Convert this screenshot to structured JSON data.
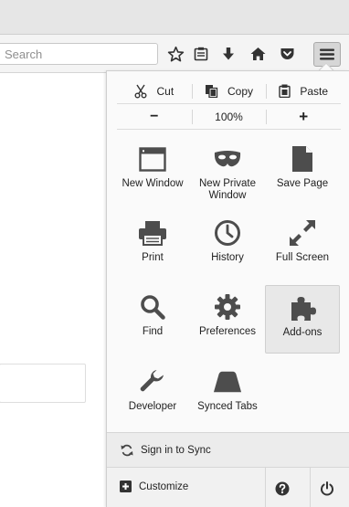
{
  "toolbar": {
    "search_placeholder": "Search",
    "bookmark_icon": "star-outline-icon",
    "reading_list_icon": "clipboard-icon",
    "downloads_icon": "download-arrow-icon",
    "home_icon": "home-icon",
    "pocket_icon": "pocket-icon",
    "menu_icon": "hamburger-icon"
  },
  "menu": {
    "edit": {
      "cut": "Cut",
      "copy": "Copy",
      "paste": "Paste"
    },
    "zoom": {
      "minus": "−",
      "level": "100%",
      "plus": "+"
    },
    "items": [
      {
        "label": "New Window",
        "icon": "window-icon"
      },
      {
        "label": "New Private Window",
        "icon": "mask-icon"
      },
      {
        "label": "Save Page",
        "icon": "page-icon"
      },
      {
        "label": "Print",
        "icon": "printer-icon"
      },
      {
        "label": "History",
        "icon": "clock-icon"
      },
      {
        "label": "Full Screen",
        "icon": "expand-arrows-icon"
      },
      {
        "label": "Find",
        "icon": "magnifier-icon"
      },
      {
        "label": "Preferences",
        "icon": "gear-icon"
      },
      {
        "label": "Add-ons",
        "icon": "puzzle-icon"
      },
      {
        "label": "Developer",
        "icon": "wrench-icon"
      },
      {
        "label": "Synced Tabs",
        "icon": "synced-tabs-icon"
      }
    ],
    "sync_label": "Sign in to Sync",
    "customize_label": "Customize",
    "icon_color": "#4d4d4d",
    "selected_tile": "Add-ons"
  }
}
